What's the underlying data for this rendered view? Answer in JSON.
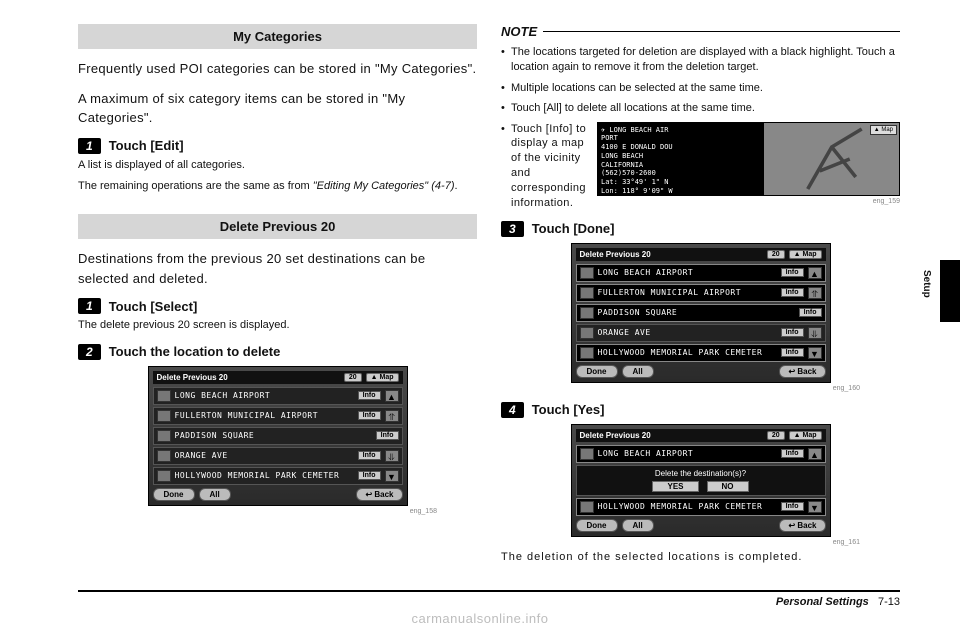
{
  "left": {
    "myCategories": {
      "heading": "My Categories",
      "p1": "Frequently used POI categories can be stored in \"My Categories\".",
      "p2": "A maximum of six category items can be stored in \"My Categories\".",
      "step1_num": "1",
      "step1_label": "Touch [Edit]",
      "fine1": "A list is displayed of all categories.",
      "fine2a": "The remaining operations are the same as from ",
      "fine2b": "\"Editing My Categories\" (4-7)",
      "fine2c": "."
    },
    "deletePrev": {
      "heading": "Delete Previous 20",
      "p1": "Destinations from the previous 20 set destinations can be selected and deleted.",
      "step1_num": "1",
      "step1_label": "Touch [Select]",
      "fine1": "The delete previous 20 screen is displayed.",
      "step2_num": "2",
      "step2_label": "Touch the location to delete"
    }
  },
  "right": {
    "noteHead": "NOTE",
    "notes": {
      "n1": "The locations targeted for deletion are displayed with a black highlight. Touch a location again to remove it from the deletion target.",
      "n2": "Multiple locations can be selected at the same time.",
      "n3": "Touch [All] to delete all locations at the same time.",
      "n4": "Touch [Info] to display a map of the vicinity and corresponding information."
    },
    "step3_num": "3",
    "step3_label": "Touch [Done]",
    "step4_num": "4",
    "step4_label": "Touch [Yes]",
    "closing": "The deletion of the selected locations is completed."
  },
  "shots": {
    "title": "Delete Previous 20",
    "count": "20",
    "mapBtn": "▲ Map",
    "infoBtn": "Info",
    "done": "Done",
    "all": "All",
    "back": "↩ Back",
    "rows": {
      "r1": "LONG BEACH AIRPORT",
      "r2": "FULLERTON MUNICIPAL AIRPORT",
      "r3": "PADDISON SQUARE",
      "r4": "ORANGE AVE",
      "r5": "HOLLYWOOD MEMORIAL PARK CEMETER"
    },
    "confirmMsg": "Delete the destination(s)?",
    "yes": "YES",
    "no": "NO",
    "miniMap": {
      "l1": "✈ LONG BEACH AIR",
      "l2": "   PORT",
      "l3": "4100 E DONALD DOU",
      "l4": "LONG BEACH",
      "l5": "CALIFORNIA",
      "l6": "(562)570-2600",
      "l7": "Lat:  33°49'  1\" N",
      "l8": "Lon: 118° 9'09\" W",
      "mapBtn": "▲ Map"
    },
    "cap158": "eng_158",
    "cap159": "eng_159",
    "cap160": "eng_160",
    "cap161": "eng_161"
  },
  "side": {
    "label": "Setup"
  },
  "footer": {
    "section": "Personal Settings",
    "page": "7-13"
  },
  "watermark": "carmanualsonline.info"
}
